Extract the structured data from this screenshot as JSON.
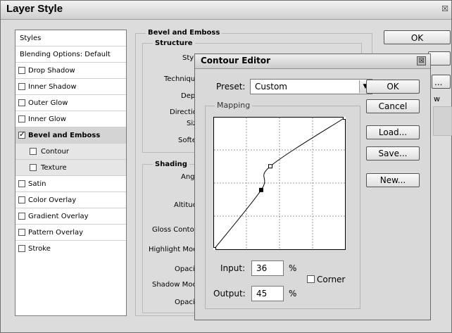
{
  "window": {
    "title": "Layer Style",
    "close_glyph": "☒"
  },
  "sidebar": {
    "header": "Styles",
    "blending": "Blending Options: Default",
    "items": [
      {
        "label": "Drop Shadow",
        "checked": false
      },
      {
        "label": "Inner Shadow",
        "checked": false
      },
      {
        "label": "Outer Glow",
        "checked": false
      },
      {
        "label": "Inner Glow",
        "checked": false
      },
      {
        "label": "Bevel and Emboss",
        "checked": true
      },
      {
        "label": "Contour",
        "checked": false
      },
      {
        "label": "Texture",
        "checked": false
      },
      {
        "label": "Satin",
        "checked": false
      },
      {
        "label": "Color Overlay",
        "checked": false
      },
      {
        "label": "Gradient Overlay",
        "checked": false
      },
      {
        "label": "Pattern Overlay",
        "checked": false
      },
      {
        "label": "Stroke",
        "checked": false
      }
    ]
  },
  "layer_buttons": {
    "ok": "OK",
    "partial_button": "...",
    "partial_label": "w"
  },
  "bevel": {
    "group": "Bevel and Emboss",
    "structure": "Structure",
    "structure_rows": [
      "Sty",
      "Techniqu",
      "Dept",
      "Directio",
      "Siz",
      "Softe"
    ],
    "shading": "Shading",
    "shading_rows": [
      "Ang",
      "Altituc",
      "Gloss Contou",
      "Highlight Moc",
      "Opacit",
      "Shadow Moc",
      "Opacit"
    ]
  },
  "contour_editor": {
    "title": "Contour Editor",
    "close_glyph": "☒",
    "preset_label": "Preset:",
    "preset_value": "Custom",
    "arrow_glyph": "▼",
    "mapping_label": "Mapping",
    "buttons": {
      "ok": "OK",
      "cancel": "Cancel",
      "load": "Load...",
      "save": "Save...",
      "new": "New..."
    },
    "input_label": "Input:",
    "input_value": "36",
    "output_label": "Output:",
    "output_value": "45",
    "percent": "%",
    "corner_label": "Corner",
    "corner_checked": false,
    "points": [
      {
        "input": 0,
        "output": 0
      },
      {
        "input": 36,
        "output": 45
      },
      {
        "input": 43,
        "output": 63
      },
      {
        "input": 100,
        "output": 100
      }
    ]
  }
}
